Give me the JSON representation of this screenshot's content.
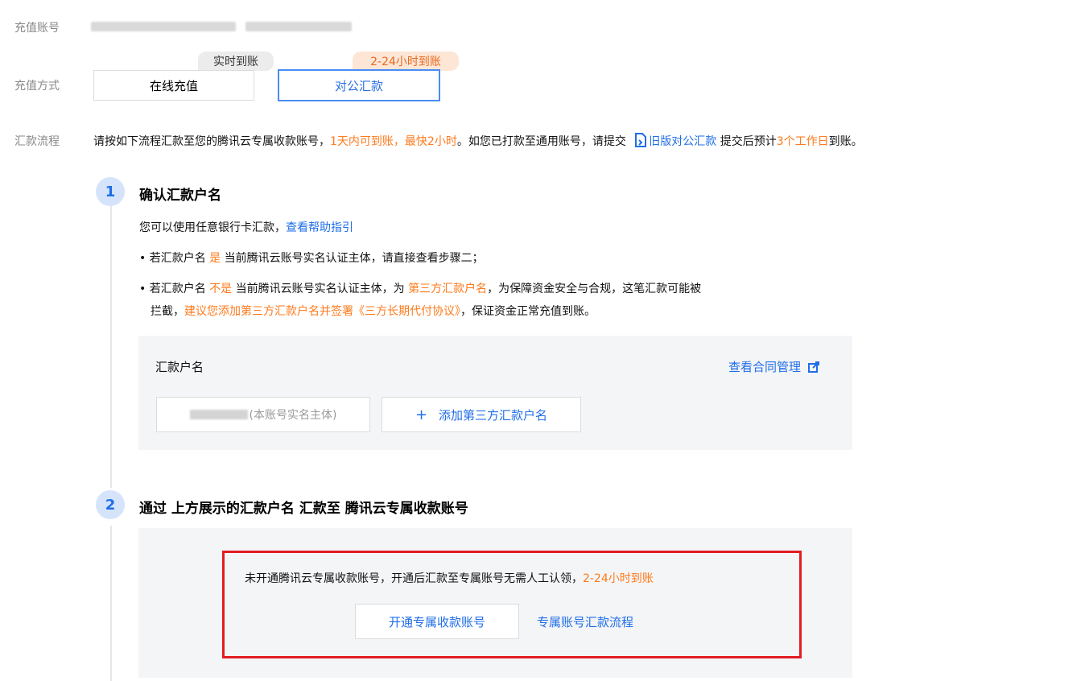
{
  "account": {
    "label": "充值账号"
  },
  "method": {
    "label": "充值方式",
    "options": [
      {
        "label": "在线充值",
        "badge": "实时到账"
      },
      {
        "label": "对公汇款",
        "badge": "2-24小时到账",
        "selected": true
      }
    ]
  },
  "flow": {
    "label": "汇款流程",
    "text_a": "请按如下流程汇款至您的腾讯云专属收款账号，",
    "text_b": "1天内可到账，最快2小时",
    "text_c": "。如您已打款至通用账号，请提交",
    "link": "旧版对公汇款",
    "text_d": "提交后预计",
    "text_e": "3个工作日",
    "text_f": "到账。"
  },
  "step1": {
    "number": "1",
    "title": "确认汇款户名",
    "intro": "您可以使用任意银行卡汇款，",
    "help_link": "查看帮助指引",
    "bullet1_a": "若汇款户名",
    "bullet1_b": "是",
    "bullet1_c": "当前腾讯云账号实名认证主体，请直接查看步骤二；",
    "bullet2_a": "若汇款户名",
    "bullet2_b": "不是",
    "bullet2_c": "当前腾讯云账号实名认证主体，为",
    "bullet2_d": "第三方汇款户名",
    "bullet2_e": "，为保障资金安全与合规，这笔汇款可能被",
    "bullet2_f": "拦截，",
    "bullet2_g": "建议您添加第三方汇款户名并签署《三方长期代付协议》",
    "bullet2_h": "，保证资金正常充值到账。",
    "panel_title": "汇款户名",
    "contract_link": "查看合同管理",
    "name_suffix": "(本账号实名主体)",
    "add_button": "添加第三方汇款户名"
  },
  "step2": {
    "number": "2",
    "title": "通过 上方展示的汇款户名 汇款至 腾讯云专属收款账号",
    "notice_a": "未开通腾讯云专属收款账号，开通后汇款至专属账号无需人工认领，",
    "notice_b": "2-24小时到账",
    "open_button": "开通专属收款账号",
    "flow_link": "专属账号汇款流程"
  },
  "colors": {
    "accent": "#1f6ee8",
    "orange": "#ff7a1c",
    "highlight": "#e31b23"
  }
}
